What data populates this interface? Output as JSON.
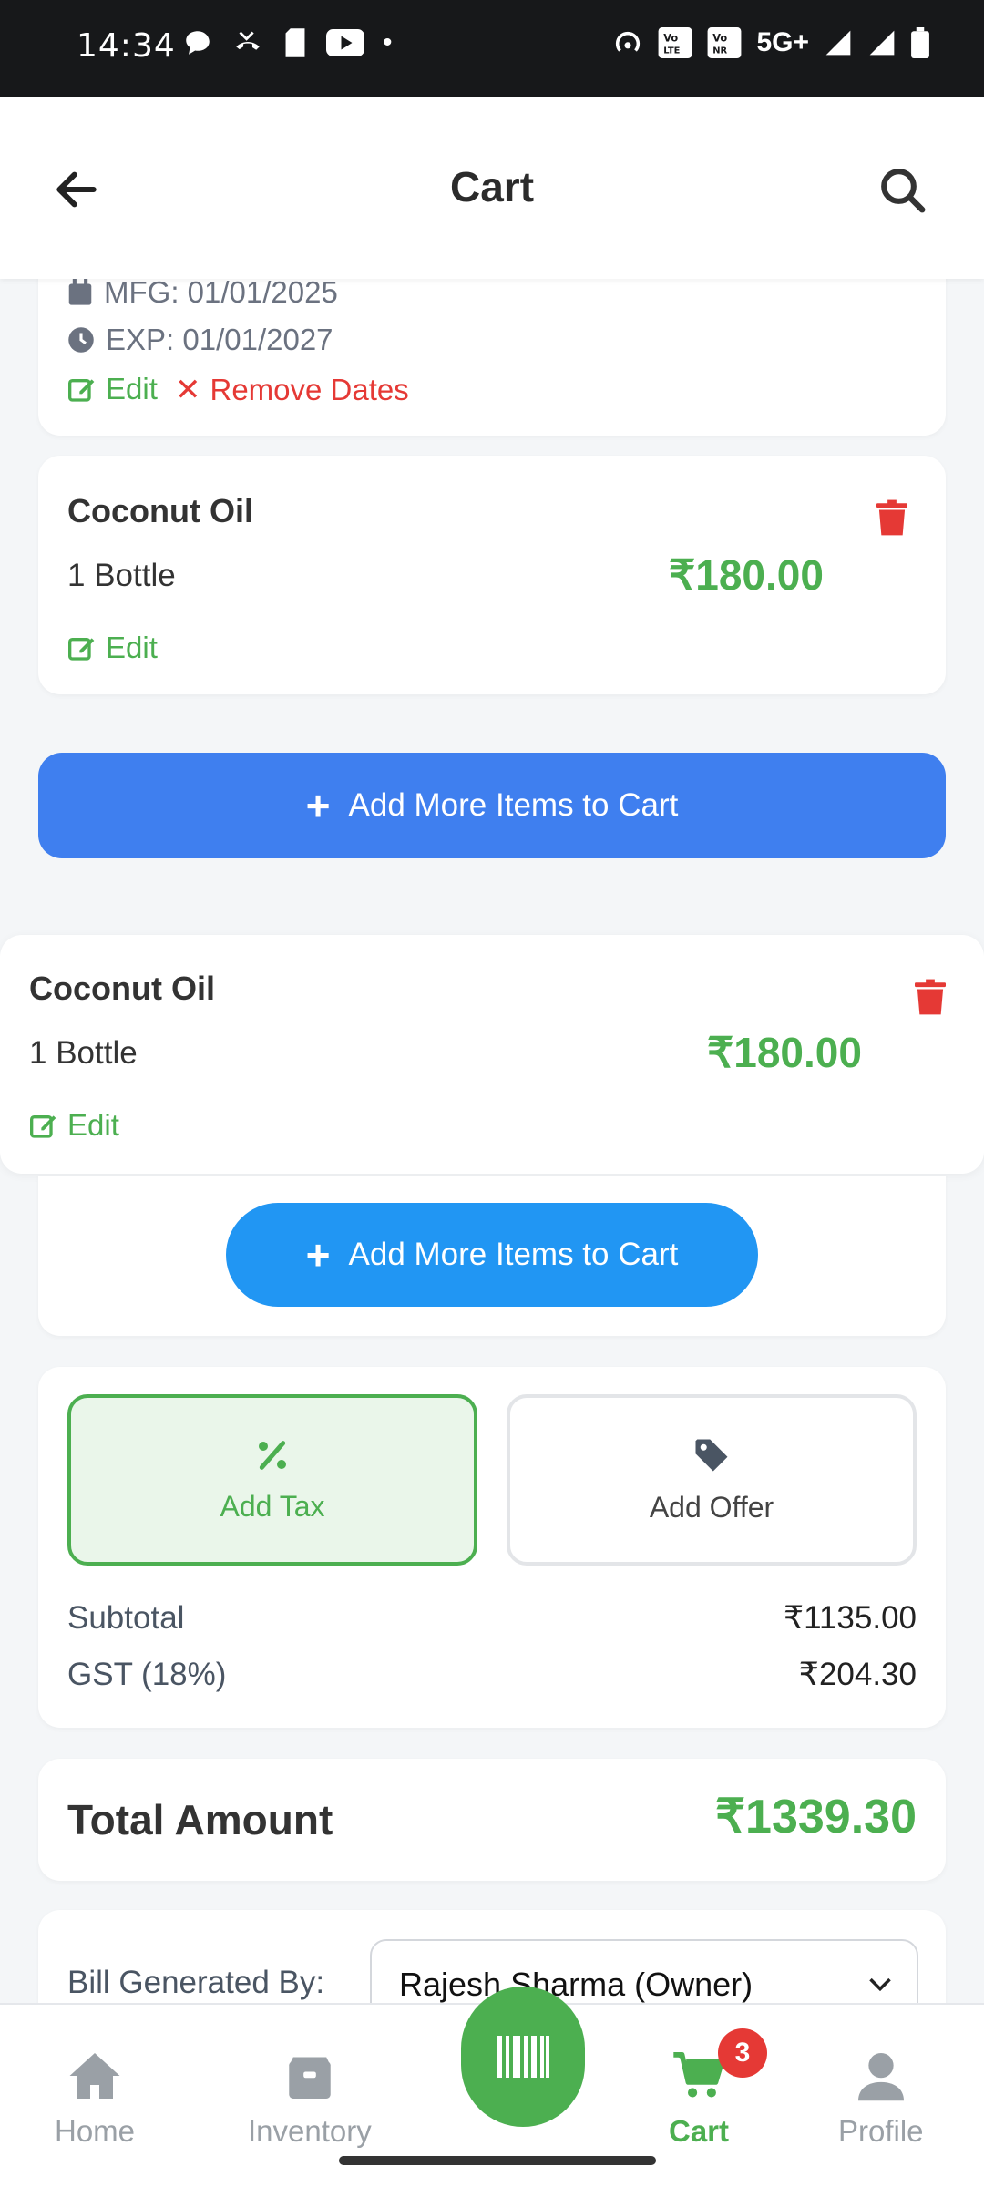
{
  "status_bar": {
    "time": "14:34",
    "network": "5G+"
  },
  "header": {
    "title": "Cart"
  },
  "first_item_partial": {
    "mfg": "MFG: 01/01/2025",
    "exp": "EXP: 01/01/2027",
    "edit_label": "Edit",
    "remove_dates_label": "Remove Dates"
  },
  "item_a": {
    "name": "Coconut Oil",
    "qty": "1 Bottle",
    "price": "₹180.00",
    "edit_label": "Edit"
  },
  "add_more_button": "Add More Items to Cart",
  "item_b": {
    "name": "Coconut Oil",
    "qty": "1 Bottle",
    "price": "₹180.00",
    "edit_label": "Edit"
  },
  "add_more_button_2": "Add More Items to Cart",
  "summary": {
    "add_tax": "Add Tax",
    "add_offer": "Add Offer",
    "subtotal_label": "Subtotal",
    "subtotal_value": "₹1135.00",
    "gst_label": "GST (18%)",
    "gst_value": "₹204.30"
  },
  "total": {
    "label": "Total Amount",
    "value": "₹1339.30"
  },
  "bill": {
    "label": "Bill Generated By:",
    "selected": "Rajesh Sharma (Owner)"
  },
  "nav": {
    "home": "Home",
    "inventory": "Inventory",
    "cart": "Cart",
    "cart_badge": "3",
    "profile": "Profile"
  },
  "colors": {
    "accent_green": "#4caf50",
    "primary_blue": "#3f7fef",
    "danger_red": "#e53935"
  }
}
